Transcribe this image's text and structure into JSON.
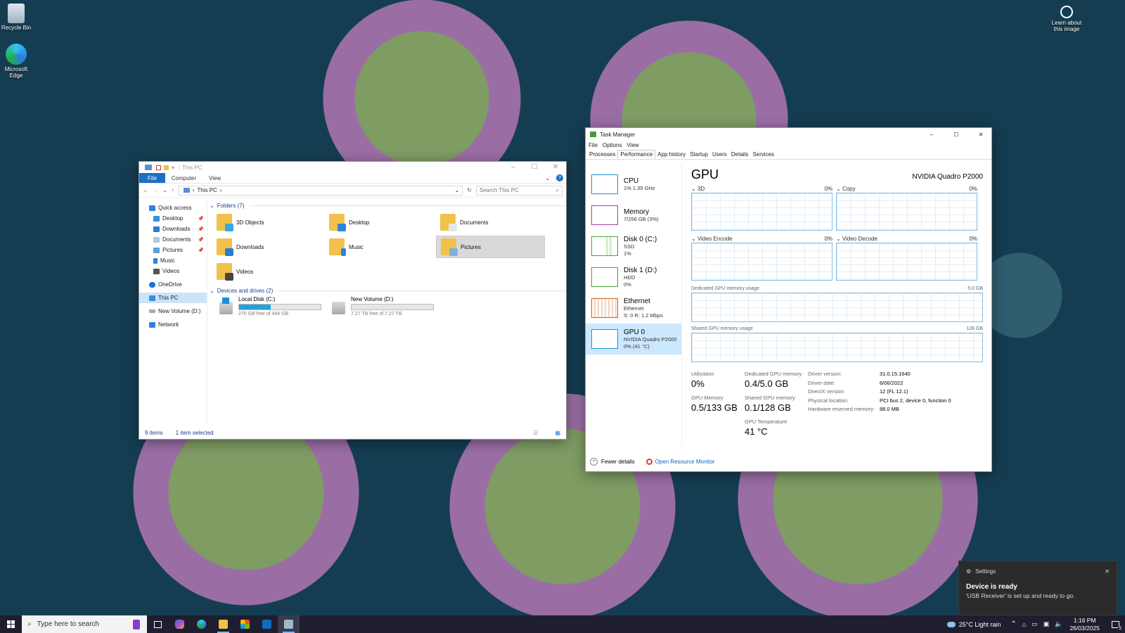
{
  "desktop": {
    "icons": [
      {
        "label": "Recycle Bin"
      },
      {
        "label": "Microsoft Edge"
      }
    ],
    "learn_label": "Learn about this image"
  },
  "explorer": {
    "title": "This PC",
    "ribbon_tabs": [
      "File",
      "Computer",
      "View"
    ],
    "breadcrumb": "This PC",
    "search_placeholder": "Search This PC",
    "nav": [
      {
        "label": "Quick access"
      },
      {
        "label": "Desktop"
      },
      {
        "label": "Downloads"
      },
      {
        "label": "Documents"
      },
      {
        "label": "Pictures"
      },
      {
        "label": "Music"
      },
      {
        "label": "Videos"
      },
      {
        "label": "OneDrive"
      },
      {
        "label": "This PC"
      },
      {
        "label": "New Volume (D:)"
      },
      {
        "label": "Network"
      }
    ],
    "folders_header": "Folders (7)",
    "folders": [
      {
        "label": "3D Objects"
      },
      {
        "label": "Desktop"
      },
      {
        "label": "Documents"
      },
      {
        "label": "Downloads"
      },
      {
        "label": "Music"
      },
      {
        "label": "Pictures"
      },
      {
        "label": "Videos"
      }
    ],
    "drives_header": "Devices and drives (2)",
    "drives": [
      {
        "label": "Local Disk (C:)",
        "free": "270 GB free of 446 GB",
        "used_fraction": 0.39
      },
      {
        "label": "New Volume (D:)",
        "free": "7.27 TB free of 7.27 TB",
        "used_fraction": 0.0
      }
    ],
    "status_items": "9 items",
    "status_selected": "1 item selected"
  },
  "taskmgr": {
    "title": "Task Manager",
    "menu": [
      "File",
      "Options",
      "View"
    ],
    "tabs": [
      "Processes",
      "Performance",
      "App history",
      "Startup",
      "Users",
      "Details",
      "Services"
    ],
    "perf_items": [
      {
        "name": "CPU",
        "sub1": "1%  1.39 GHz",
        "sub2": "",
        "color": "#1f8fd6"
      },
      {
        "name": "Memory",
        "sub1": "7/256 GB (3%)",
        "sub2": "",
        "color": "#a43aa8"
      },
      {
        "name": "Disk 0 (C:)",
        "sub1": "SSD",
        "sub2": "1%",
        "color": "#4aa332"
      },
      {
        "name": "Disk 1 (D:)",
        "sub1": "HDD",
        "sub2": "0%",
        "color": "#4aa332"
      },
      {
        "name": "Ethernet",
        "sub1": "Ethernet",
        "sub2": "S: 0  R: 1.2 Mbps",
        "color": "#c0631f"
      },
      {
        "name": "GPU 0",
        "sub1": "NVIDIA Quadro P2000",
        "sub2": "0%  (41 °C)",
        "color": "#1f8fd6"
      }
    ],
    "gpu": {
      "heading": "GPU",
      "model": "NVIDIA Quadro P2000",
      "graphs": [
        {
          "label": "3D",
          "pct": "0%"
        },
        {
          "label": "Copy",
          "pct": "0%"
        },
        {
          "label": "Video Encode",
          "pct": "0%"
        },
        {
          "label": "Video Decode",
          "pct": "0%"
        }
      ],
      "dedicated_label": "Dedicated GPU memory usage",
      "dedicated_max": "5.0 GB",
      "shared_label": "Shared GPU memory usage",
      "shared_max": "128 GB",
      "stats": [
        {
          "label": "Utilization",
          "value": "0%"
        },
        {
          "label": "Dedicated GPU memory",
          "value": "0.4/5.0 GB"
        },
        {
          "label": "GPU Memory",
          "value": "0.5/133 GB"
        },
        {
          "label": "Shared GPU memory",
          "value": "0.1/128 GB"
        },
        {
          "label": "GPU Temperature",
          "value": "41 °C"
        }
      ],
      "details": [
        {
          "k": "Driver version:",
          "v": "31.0.15.1640"
        },
        {
          "k": "Driver date:",
          "v": "6/06/2022"
        },
        {
          "k": "DirectX version:",
          "v": "12 (FL 12.1)"
        },
        {
          "k": "Physical location:",
          "v": "PCI bus 2, device 0, function 0"
        },
        {
          "k": "Hardware reserved memory:",
          "v": "88.0 MB"
        }
      ]
    },
    "fewer_details": "Fewer details",
    "open_resmon": "Open Resource Monitor"
  },
  "toast": {
    "app": "Settings",
    "title": "Device is ready",
    "body": "'USB Receiver' is set up and ready to go."
  },
  "taskbar": {
    "search_placeholder": "Type here to search",
    "weather": "25°C  Light rain",
    "time": "1:16 PM",
    "date": "26/03/2025",
    "notif_count": "5"
  }
}
